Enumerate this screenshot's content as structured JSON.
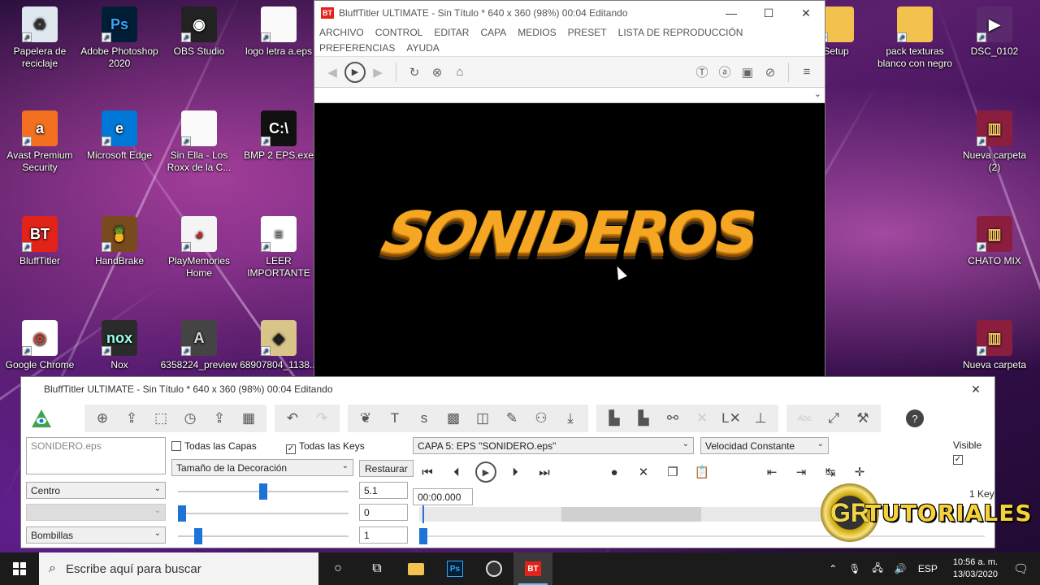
{
  "desktop": {
    "icons_left": [
      {
        "label": "Papelera de reciclaje",
        "icon": "recycle-bin-icon"
      },
      {
        "label": "Adobe Photoshop 2020",
        "icon": "photoshop-icon"
      },
      {
        "label": "OBS Studio",
        "icon": "obs-icon"
      },
      {
        "label": "logo letra a.eps",
        "icon": "file-icon"
      },
      {
        "label": "Avast Premium Security",
        "icon": "avast-icon"
      },
      {
        "label": "Microsoft Edge",
        "icon": "edge-icon"
      },
      {
        "label": "Sin Ella - Los Roxx de la C...",
        "icon": "file-icon"
      },
      {
        "label": "BMP 2 EPS.exe",
        "icon": "console-icon"
      },
      {
        "label": "BluffTitler",
        "icon": "blufftitler-icon"
      },
      {
        "label": "HandBrake",
        "icon": "handbrake-icon"
      },
      {
        "label": "PlayMemories Home",
        "icon": "playmemories-icon"
      },
      {
        "label": "LEER IMPORTANTE",
        "icon": "text-file-icon"
      },
      {
        "label": "Google Chrome",
        "icon": "chrome-icon"
      },
      {
        "label": "Nox",
        "icon": "nox-icon"
      },
      {
        "label": "6358224_preview",
        "icon": "avengers-icon"
      },
      {
        "label": "68907804_1138...",
        "icon": "image-icon"
      }
    ],
    "icons_right": [
      {
        "label": "Setup",
        "icon": "folder-icon"
      },
      {
        "label": "pack texturas blanco con negro",
        "icon": "folder-icon"
      },
      {
        "label": "DSC_0102",
        "icon": "video-icon"
      },
      {
        "label": "Nueva carpeta (2)",
        "icon": "winrar-icon"
      },
      {
        "label": "CHATO MIX",
        "icon": "winrar-icon"
      },
      {
        "label": "Nueva carpeta",
        "icon": "winrar-icon"
      }
    ]
  },
  "preview_window": {
    "title": "BluffTitler ULTIMATE  - Sin Título * 640 x 360 (98%) 00:04 Editando",
    "logo_text": "BT",
    "minimize": "—",
    "maximize": "☐",
    "close": "✕",
    "menu": [
      "ARCHIVO",
      "CONTROL",
      "EDITAR",
      "CAPA",
      "MEDIOS",
      "PRESET",
      "LISTA DE REPRODUCCIÓN",
      "PREFERENCIAS",
      "AYUDA"
    ],
    "preview_text": "SONIDEROS"
  },
  "editor_window": {
    "title": "BluffTitler ULTIMATE  - Sin Título * 640 x 360 (98%) 00:04 Editando",
    "close": "✕",
    "layer_name": "SONIDERO.eps",
    "all_layers_label": "Todas las Capas",
    "all_keys_label": "Todas las Keys",
    "layer_select": "CAPA   5: EPS \"SONIDERO.eps\"",
    "speed_select": "Velocidad Constante",
    "visible_label": "Visible",
    "property_select": "Tamaño de la Decoración",
    "restore_label": "Restaurar",
    "center_select": "Centro",
    "bulbs_select": "Bombillas",
    "value1": "5.1",
    "value2": "0",
    "value3": "1",
    "time": "00:00.000",
    "keys_count": "1 Key",
    "slider1_fraction": 0.5,
    "slider2_fraction": 0.0,
    "slider3_fraction": 0.1
  },
  "watermark": {
    "gr": "GR",
    "text": "TUTORIALES"
  },
  "taskbar": {
    "search_placeholder": "Escribe aquí para buscar",
    "language": "ESP",
    "time": "10:56 a. m.",
    "date": "13/03/2020"
  }
}
